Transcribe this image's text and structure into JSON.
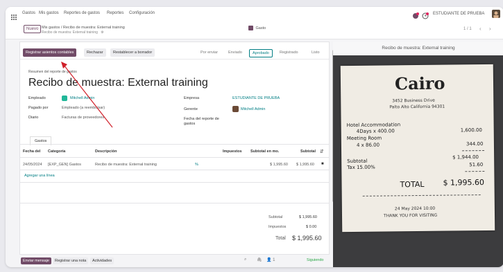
{
  "navbar": {
    "menu": [
      "Gastos",
      "Mis gastos",
      "Reportes de gastos",
      "Reportes",
      "Configuración"
    ],
    "company": "ESTUDIANTE DE PRUEBA"
  },
  "control": {
    "new_label": "Nuevo",
    "breadcrumb": "Mis gastos / Recibo de muestra: External training",
    "breadcrumb_sub": "Recibo de muestra: External training",
    "pager": "1 / 1",
    "chat_label": "Gasto"
  },
  "statusbar": {
    "primary": "Registrar asientos contables",
    "refuse": "Rechazar",
    "reset": "Restablecer a borrador",
    "stages": [
      "Por enviar",
      "Enviado",
      "Aprobado",
      "Registrado",
      "Listo"
    ],
    "active_stage": "Aprobado"
  },
  "sheet": {
    "subtitle_label": "Resumen del reporte de gastos",
    "title": "Recibo de muestra: External training",
    "fields": {
      "employee_label": "Empleado",
      "employee_value": "Mitchell Admin",
      "paid_by_label": "Pagado por",
      "paid_by_value": "Empleado (a reembolsar)",
      "journal_label": "Diario",
      "journal_value": "Facturas de proveedores",
      "company_label": "Empresa",
      "company_value": "ESTUDIANTE DE PRUEBA",
      "manager_label": "Gerente",
      "manager_value": "Mitchell Admin",
      "date_label": "Fecha del reporte de gastos"
    },
    "tab_label": "Gastos",
    "table": {
      "headers": [
        "Fecha del",
        "Categoría",
        "Descripción",
        "Impuestos",
        "Subtotal en mo.",
        "Subtotal"
      ],
      "row": [
        "24/05/2024",
        "[EXP_GEN] Gastos",
        "Recibo de muestra: External training",
        "%",
        "$ 1,995.60",
        "$ 1,995.60"
      ],
      "add_line": "Agregar una línea"
    },
    "totals": {
      "subtotal_label": "Subtotal",
      "subtotal_value": "$ 1,995.60",
      "taxes_label": "Impuestos",
      "taxes_value": "$ 0.00",
      "total_label": "Total",
      "total_value": "$ 1,995.60"
    }
  },
  "chatter": {
    "send": "Enviar mensaje",
    "log": "Registrar una nota",
    "activities": "Actividades",
    "follow": "Siguiendo",
    "followers": "1"
  },
  "preview": {
    "title": "Recibo de muestra: External training",
    "receipt": {
      "logo": "Cairo",
      "address1": "3452 Business Drive",
      "address2": "Palto Alto California 94301",
      "line1_label": "Hotel Accommodation",
      "line1_detail": "4Days x 400.00",
      "line1_value": "1,600.00",
      "line2_label": "Meeting Room",
      "line2_detail": "4 x 86.00",
      "line2_value": "344.00",
      "subtotal_label": "Subtotal",
      "subtotal_value": "$ 1,944.00",
      "tax_label": "Tax 15.00%",
      "tax_value": "51.60",
      "total_label": "TOTAL",
      "total_value": "$ 1,995.60",
      "date": "24 May 2024   10:00",
      "thanks": "THANK YOU FOR VISITING"
    }
  },
  "colors": {
    "brand": "#714b67",
    "accent": "#017e84",
    "arrow": "#d0202a"
  }
}
